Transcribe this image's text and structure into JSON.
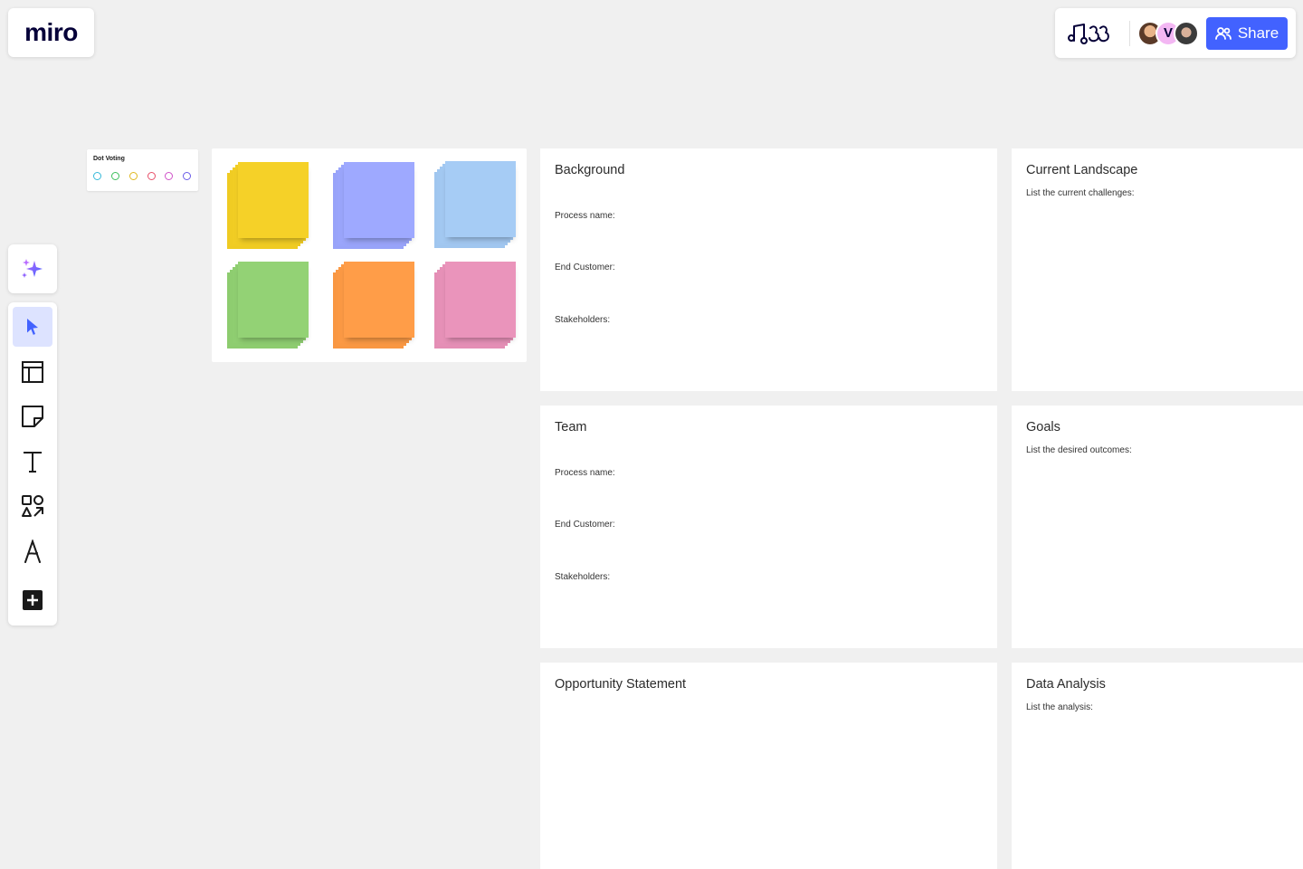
{
  "app": {
    "logo_text": "miro"
  },
  "header": {
    "share_label": "Share",
    "collaborators": [
      {
        "name": "photo-avatar-1",
        "initial": "",
        "color": "#c9915f"
      },
      {
        "name": "initial-avatar-v",
        "initial": "V",
        "color": "#f3b7f3"
      },
      {
        "name": "photo-avatar-2",
        "initial": "",
        "color": "#8a6a5a"
      }
    ]
  },
  "toolbar": {
    "ai_icon": "sparkle-icon",
    "tools": [
      {
        "name": "select-tool",
        "icon": "cursor-icon",
        "active": true
      },
      {
        "name": "templates-tool",
        "icon": "layout-icon",
        "active": false
      },
      {
        "name": "sticky-note-tool",
        "icon": "sticky-note-icon",
        "active": false
      },
      {
        "name": "text-tool",
        "icon": "text-icon",
        "active": false
      },
      {
        "name": "shapes-tool",
        "icon": "shapes-icon",
        "active": false
      },
      {
        "name": "pen-tool",
        "icon": "pen-icon",
        "active": false
      },
      {
        "name": "more-tools",
        "icon": "plus-icon",
        "active": false
      }
    ]
  },
  "dot_voting": {
    "title": "Dot Voting",
    "dot_colors": [
      "#36b9d9",
      "#3dbf5c",
      "#e0b820",
      "#e8506a",
      "#d052c9",
      "#6a5ce8"
    ]
  },
  "sticky_palette": {
    "colors": [
      "#f5d128",
      "#9ea9ff",
      "#a6ccf5",
      "#93d275",
      "#ff9d48",
      "#ea94bb"
    ]
  },
  "frames": {
    "background": {
      "title": "Background",
      "fields": [
        "Process name:",
        "End Customer:",
        "Stakeholders:"
      ]
    },
    "current_landscape": {
      "title": "Current Landscape",
      "subtitle": "List the current challenges:"
    },
    "team": {
      "title": "Team",
      "fields": [
        "Process name:",
        "End Customer:",
        "Stakeholders:"
      ]
    },
    "goals": {
      "title": "Goals",
      "subtitle": "List the desired outcomes:"
    },
    "opportunity": {
      "title": "Opportunity Statement"
    },
    "data_analysis": {
      "title": "Data Analysis",
      "subtitle": "List the analysis:"
    }
  }
}
